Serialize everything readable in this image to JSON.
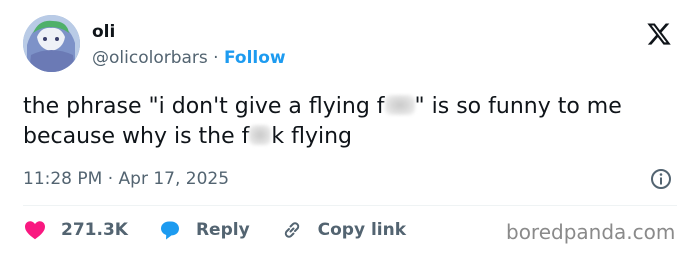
{
  "author": {
    "name": "oli",
    "handle": "@olicolorbars",
    "separator": "·",
    "follow_label": "Follow"
  },
  "tweet": {
    "text_part1": "the phrase \"i don't give a flying f",
    "text_part2": "\" is so funny to me because why is the f",
    "text_part3": "k flying",
    "timestamp": "11:28 PM · Apr 17, 2025"
  },
  "actions": {
    "like_count": "271.3K",
    "reply_label": "Reply",
    "copy_link_label": "Copy link"
  },
  "watermark": "boredpanda.com",
  "icons": [
    "x-logo-icon",
    "info-icon",
    "heart-icon",
    "reply-bubble-icon",
    "link-icon"
  ],
  "colors": {
    "accent": "#1d9bf0",
    "like": "#f91880",
    "secondary_text": "#536471",
    "text": "#0f1419"
  }
}
